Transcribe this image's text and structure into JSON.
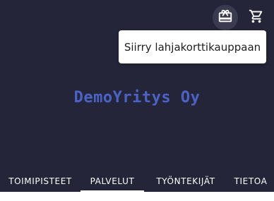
{
  "header": {
    "gift_icon": "card-giftcard-icon",
    "cart_icon": "shopping-cart-icon",
    "tooltip": "Siirry lahjakorttikauppaan",
    "brand": "DemoYritys Oy"
  },
  "tabs": [
    {
      "label": "TOIMIPISTEET",
      "active": false
    },
    {
      "label": "PALVELUT",
      "active": true
    },
    {
      "label": "TYÖNTEKIJÄT",
      "active": false
    },
    {
      "label": "TIETOA",
      "active": false
    }
  ],
  "colors": {
    "header_bg": "#25253a",
    "brand": "#4b63c6",
    "tab_text": "#ffffff"
  }
}
